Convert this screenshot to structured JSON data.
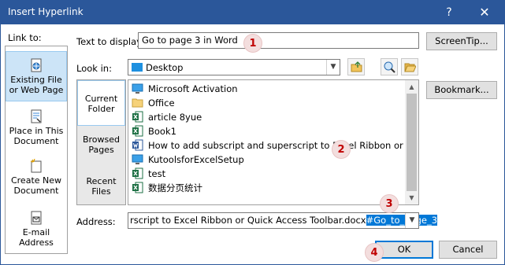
{
  "window": {
    "title": "Insert Hyperlink",
    "help_glyph": "?",
    "close_glyph": "✕"
  },
  "link_to": {
    "label": "Link to:",
    "items": [
      {
        "line1": "Existing File",
        "line2": "or Web Page",
        "icon": "globe-file-icon"
      },
      {
        "line1": "Place in This",
        "line2": "Document",
        "icon": "place-document-icon"
      },
      {
        "line1": "Create New",
        "line2": "Document",
        "icon": "new-document-icon"
      },
      {
        "line1": "E-mail",
        "line2": "Address",
        "icon": "email-icon"
      }
    ]
  },
  "text_to_display": {
    "label": "Text to display:",
    "value": "Go to page 3 in Word"
  },
  "screentip_button": "ScreenTip...",
  "look_in": {
    "label": "Look in:",
    "value": "Desktop"
  },
  "sub_nav": [
    {
      "line1": "Current",
      "line2": "Folder"
    },
    {
      "line1": "Browsed",
      "line2": "Pages"
    },
    {
      "line1": "Recent",
      "line2": "Files"
    }
  ],
  "bookmark_button": "Bookmark...",
  "files": [
    {
      "name": "Microsoft Activation",
      "type": "app"
    },
    {
      "name": "Office",
      "type": "folder"
    },
    {
      "name": "article 8yue",
      "type": "excel"
    },
    {
      "name": "Book1",
      "type": "excel"
    },
    {
      "name": "How to add subscript and superscript to Excel Ribbon or Quick",
      "type": "word"
    },
    {
      "name": "KutoolsforExcelSetup",
      "type": "app"
    },
    {
      "name": "test",
      "type": "excel"
    },
    {
      "name": "数据分页统计",
      "type": "excel"
    }
  ],
  "address": {
    "label": "Address:",
    "value_plain": "rscript to Excel Ribbon or Quick Access Toolbar.docx",
    "value_selected": "#Go_to_page_3"
  },
  "ok_button": "OK",
  "cancel_button": "Cancel",
  "badges": [
    "1",
    "2",
    "3",
    "4"
  ],
  "colors": {
    "title_bar": "#2b579a",
    "selection": "#0078d7",
    "badge_text": "#c00000"
  }
}
